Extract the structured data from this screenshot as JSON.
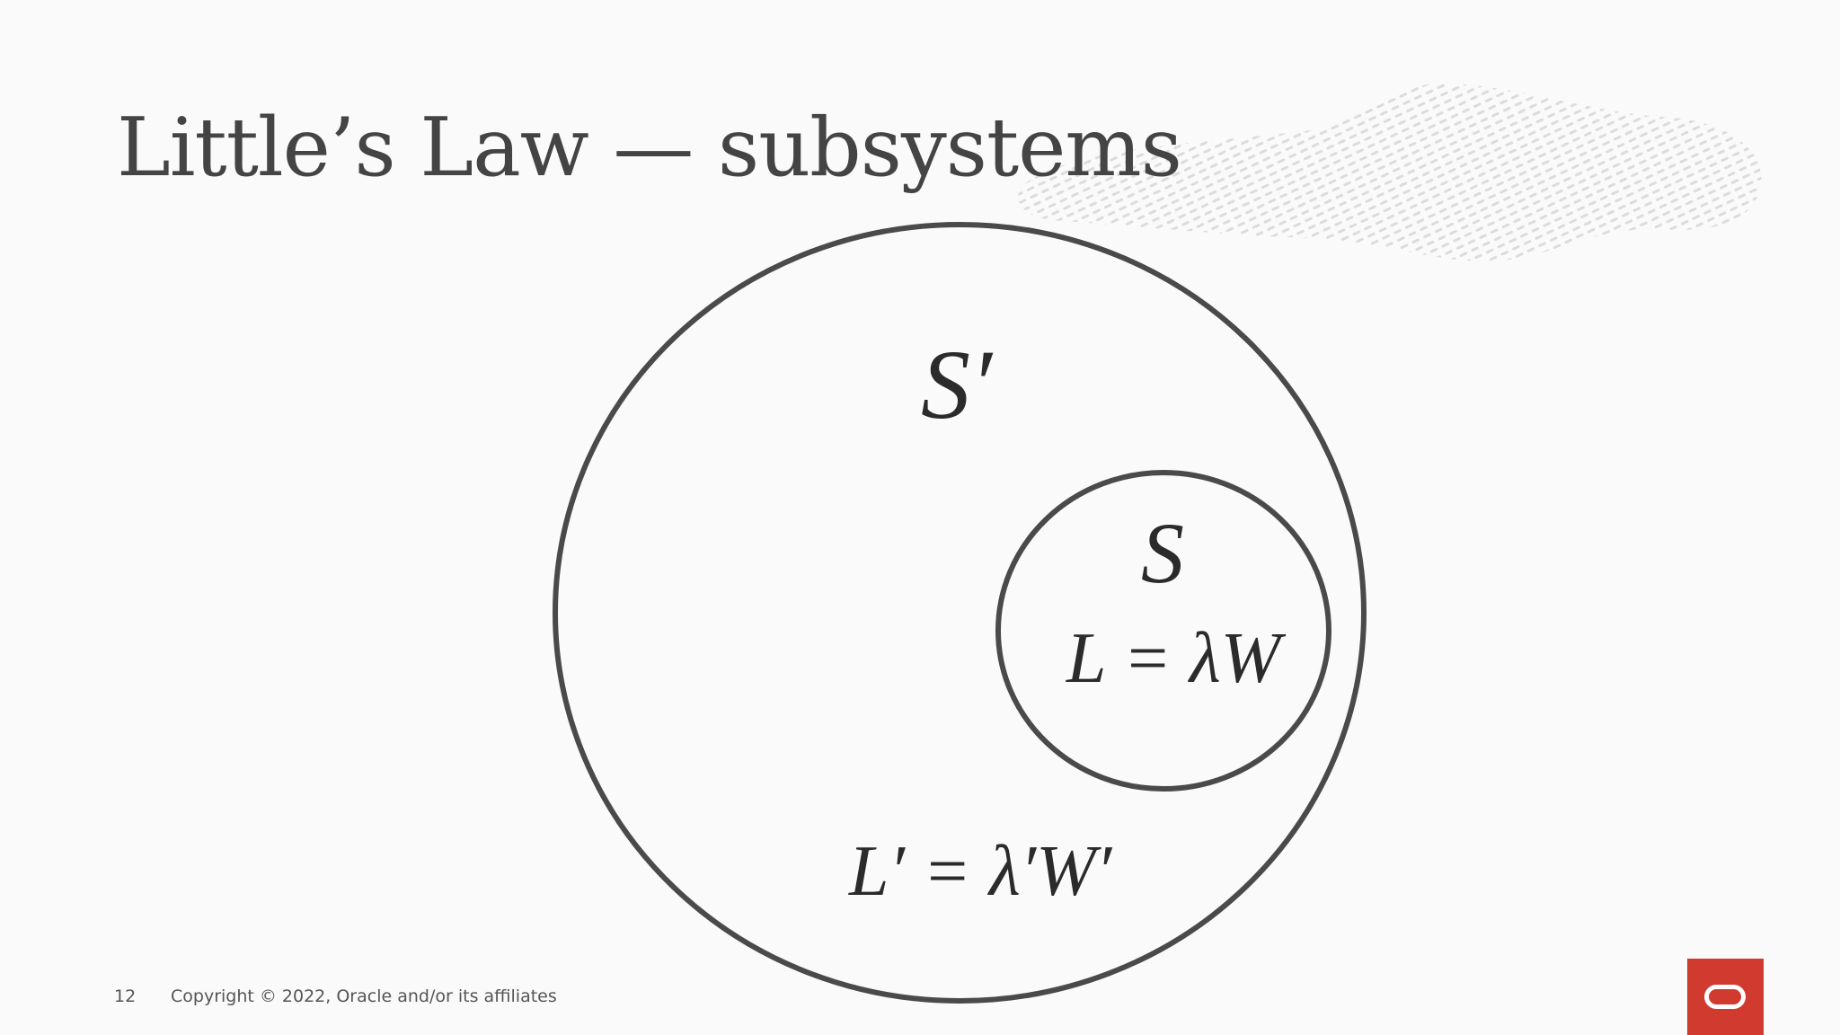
{
  "slide": {
    "title": "Little’s Law — subsystems",
    "page_number": "12",
    "copyright": "Copyright © 2022, Oracle and/or its affiliates"
  },
  "diagram": {
    "outer_system_label": "S′",
    "inner_system_label": "S",
    "inner_equation": "L = λW",
    "outer_equation": "L′ = λ′W′"
  },
  "colors": {
    "background": "#fafafa",
    "title": "#444444",
    "circle_stroke": "#4a4a4a",
    "brand_red": "#d13a2f"
  },
  "icons": {
    "brand_logo": "oracle-logo-icon",
    "decoration": "texture-brushstroke"
  }
}
